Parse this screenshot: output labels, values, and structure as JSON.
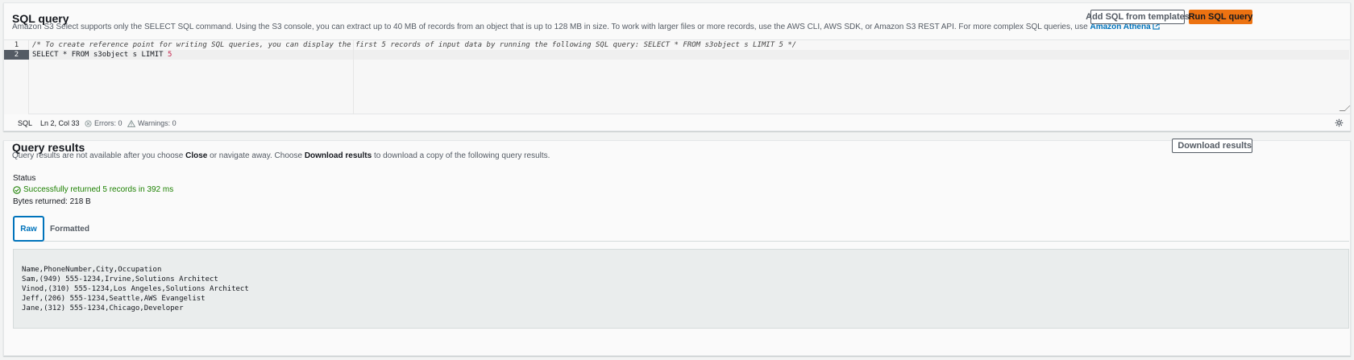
{
  "sql_panel": {
    "title": "SQL query",
    "description_pre": "Amazon S3 Select supports only the SELECT SQL command. Using the S3 console, you can extract up to 40 MB of records from an object that is up to 128 MB in size. To work with larger files or more records, use the AWS CLI, AWS SDK, or Amazon S3 REST API. For more complex SQL queries, use",
    "athena_link": "Amazon Athena",
    "add_templates_button": "Add SQL from templates",
    "run_button": "Run SQL query",
    "editor": {
      "line_numbers": [
        "1",
        "2"
      ],
      "line1_comment": "/* To create reference point for writing SQL queries, you can display the first 5 records of input data by running the following SQL query: SELECT * FROM s3object s LIMIT 5 */",
      "line2_a": "SELECT * FROM s3object s LIMIT ",
      "line2_num": "5"
    },
    "statusbar": {
      "language": "SQL",
      "position": "Ln 2, Col 33",
      "errors": "Errors: 0",
      "warnings": "Warnings: 0"
    }
  },
  "results_panel": {
    "title": "Query results",
    "desc_1": "Query results are not available after you choose ",
    "desc_close": "Close",
    "desc_2": " or navigate away. Choose ",
    "desc_download": "Download results",
    "desc_3": " to download a copy of the following query results.",
    "download_button": "Download results",
    "status_label": "Status",
    "status_text": "Successfully returned 5 records in 392 ms",
    "bytes_returned": "Bytes returned: 218 B",
    "tabs": [
      "Raw",
      "Formatted"
    ],
    "raw_lines": [
      "Name,PhoneNumber,City,Occupation",
      "Sam,(949) 555-1234,Irvine,Solutions Architect",
      "Vinod,(310) 555-1234,Los Angeles,Solutions Architect",
      "Jeff,(206) 555-1234,Seattle,AWS Evangelist",
      "Jane,(312) 555-1234,Chicago,Developer"
    ]
  },
  "colors": {
    "primary": "#ec7211",
    "link": "#0073bb",
    "success": "#1d8102"
  }
}
